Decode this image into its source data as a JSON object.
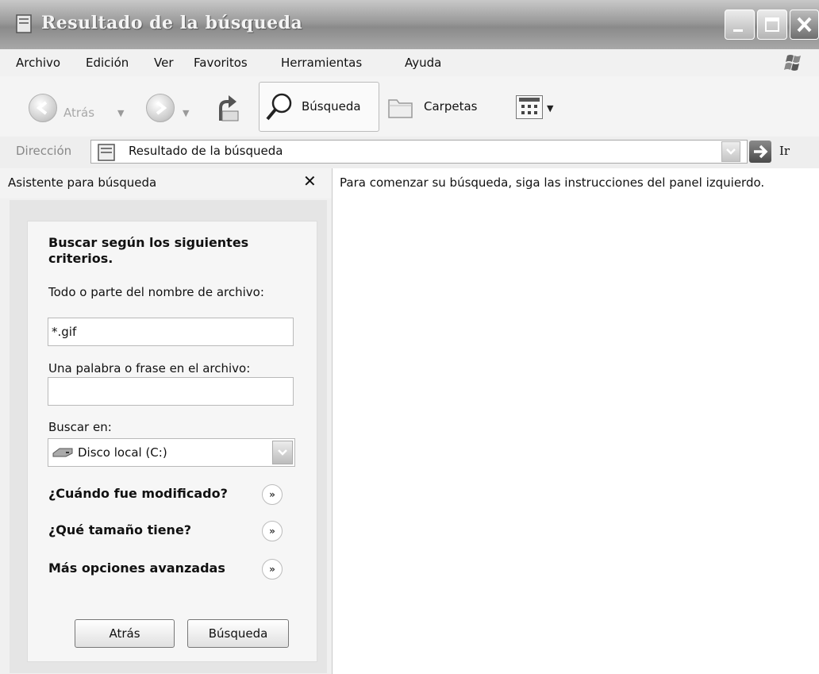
{
  "window": {
    "title": "Resultado de la búsqueda"
  },
  "menu": {
    "items": [
      "Archivo",
      "Edición",
      "Ver",
      "Favoritos",
      "Herramientas",
      "Ayuda"
    ]
  },
  "toolbar": {
    "back_label": "Atrás",
    "search_label": "Búsqueda",
    "folders_label": "Carpetas"
  },
  "address": {
    "label": "Dirección",
    "value": "Resultado de la búsqueda",
    "go_label": "Ir"
  },
  "search_pane": {
    "title": "Asistente para búsqueda",
    "heading": "Buscar según los siguientes criterios.",
    "filename_label": "Todo o parte del nombre de archivo:",
    "filename_value": "*.gif",
    "phrase_label": "Una palabra o frase en el archivo:",
    "phrase_value": "",
    "lookin_label": "Buscar en:",
    "lookin_value": "Disco local (C:)",
    "when_modified": "¿Cuándo fue modificado?",
    "what_size": "¿Qué tamaño tiene?",
    "more_options": "Más opciones avanzadas",
    "back_button": "Atrás",
    "search_button": "Búsqueda"
  },
  "results": {
    "message": "Para comenzar su búsqueda, siga las instrucciones del panel izquierdo."
  }
}
